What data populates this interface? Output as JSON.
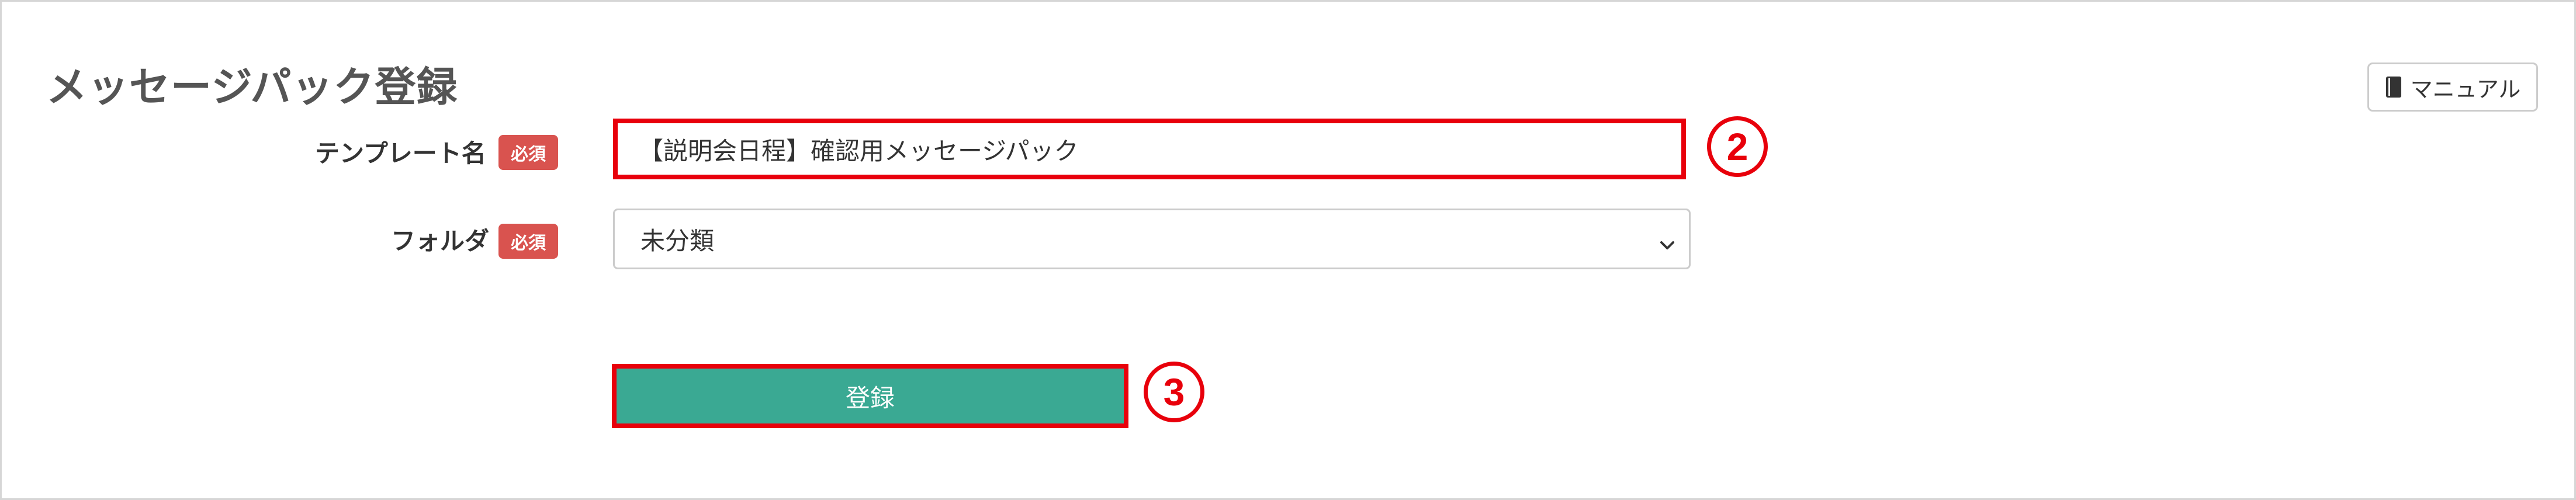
{
  "page": {
    "title": "メッセージパック登録"
  },
  "toolbar": {
    "manual_label": "マニュアル",
    "manual_icon": "book-icon"
  },
  "form": {
    "required_badge": "必須",
    "template_name": {
      "label": "テンプレート名",
      "value": "【説明会日程】確認用メッセージパック"
    },
    "folder": {
      "label": "フォルダ",
      "selected": "未分類"
    },
    "submit_label": "登録"
  },
  "annotations": {
    "step_2": "2",
    "step_3": "3"
  },
  "colors": {
    "accent_button": "#3aa993",
    "badge": "#d9534f",
    "highlight": "#e8000b",
    "title_text": "#555555"
  }
}
